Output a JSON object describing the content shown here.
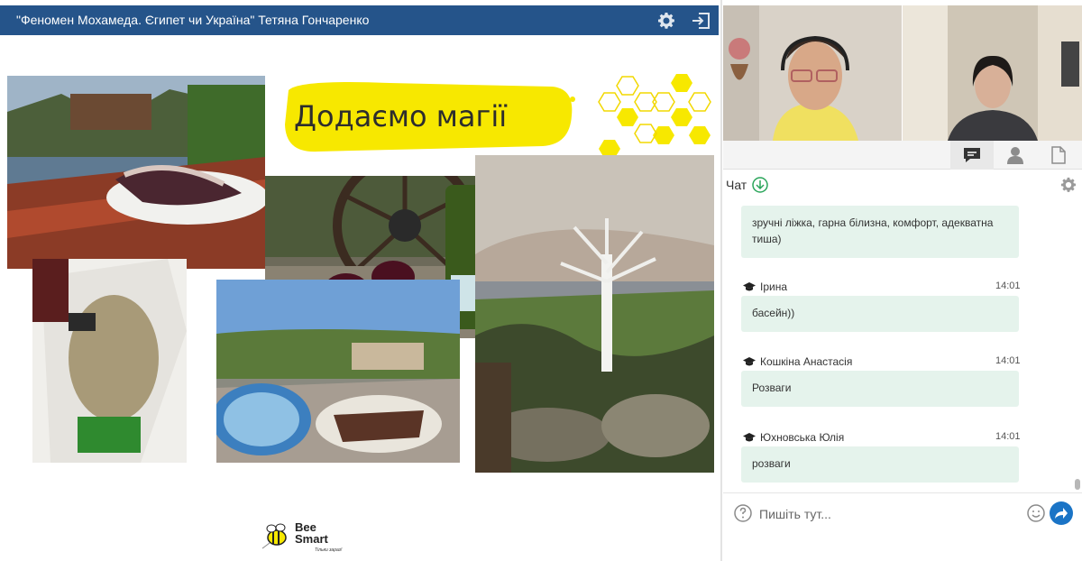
{
  "presentation": {
    "title": "\"Феномен Мохамеда. Єгипет чи Україна\" Тетяна Гончаренко",
    "gear_icon": "gear-icon",
    "exit_icon": "exit-icon"
  },
  "slide": {
    "heading": "Додаємо магії",
    "logo": {
      "line1": "Bee",
      "line2": "Smart",
      "tagline": "Тільки зараз!"
    }
  },
  "tabs": [
    {
      "icon": "chat-icon",
      "active": true
    },
    {
      "icon": "user-icon",
      "active": false
    },
    {
      "icon": "document-icon",
      "active": false
    }
  ],
  "chat": {
    "label": "Чат",
    "messages": [
      {
        "name": "",
        "time": "",
        "text_line1": "зручні ліжка, гарна білизна, комфорт, адекватна",
        "text_line2": "тиша)"
      },
      {
        "name": "Ірина",
        "time": "14:01",
        "text": "басейн))"
      },
      {
        "name": "Кошкіна Анастасія",
        "time": "14:01",
        "text": "Розваги"
      },
      {
        "name": "Юхновська Юлія",
        "time": "14:01",
        "text": "розваги"
      }
    ],
    "input_placeholder": "Пишіть тут..."
  },
  "colors": {
    "titlebar": "#25548a",
    "bubble": "#e5f3ec",
    "accent_yellow": "#f7e800",
    "send": "#1a74c6"
  }
}
